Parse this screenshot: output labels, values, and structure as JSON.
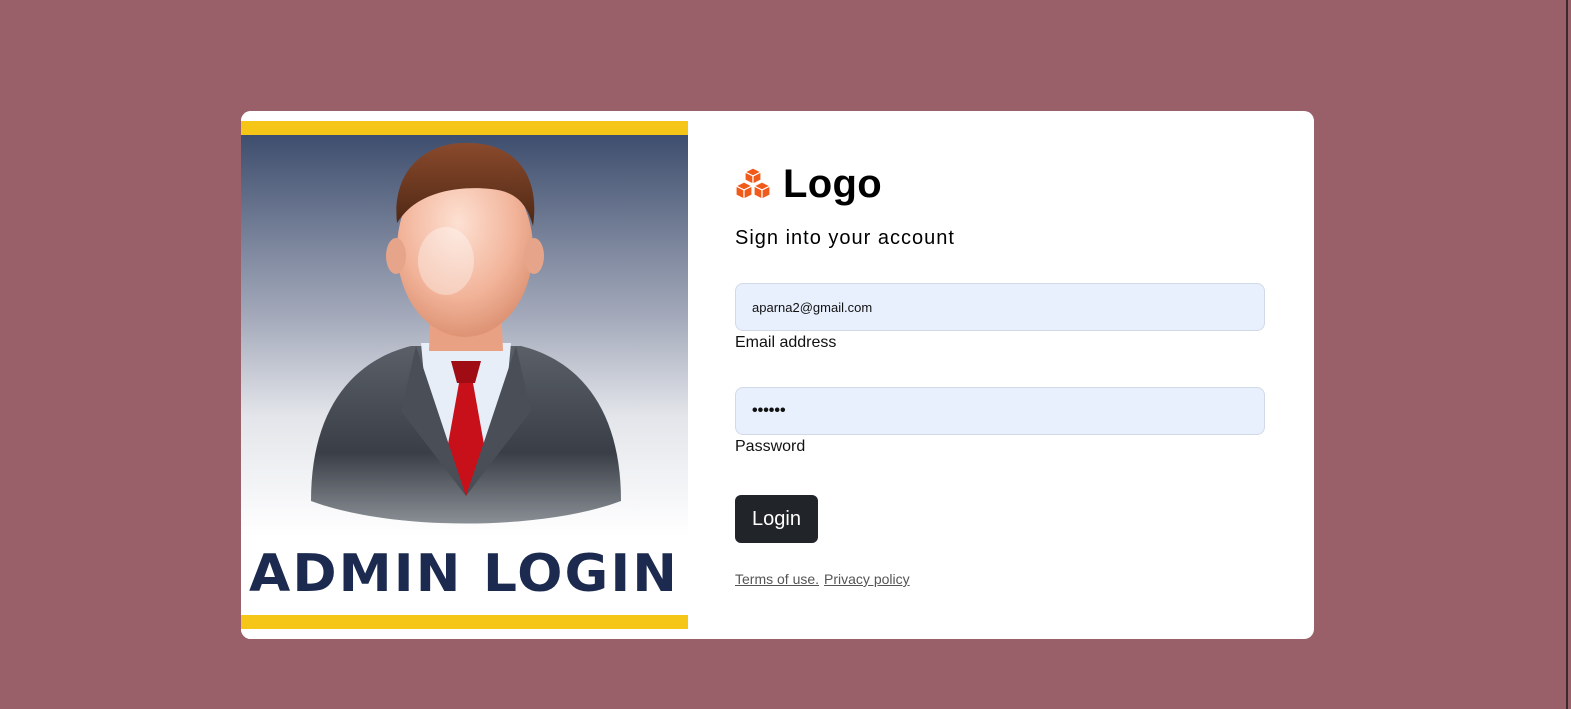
{
  "hero": {
    "image_text": "ADMIN LOGIN",
    "colors": {
      "stripe": "#f5c518",
      "title": "#1b2a4e",
      "tie": "#c8101a",
      "suit": "#3a3f47"
    }
  },
  "brand": {
    "icon": "cubes-icon",
    "icon_color": "#f05a1a",
    "name": "Logo"
  },
  "form": {
    "subtitle": "Sign into your account",
    "email_value": "aparna2@gmail.com",
    "email_label": "Email address",
    "password_value": "••••••",
    "password_label": "Password",
    "login_label": "Login"
  },
  "footer": {
    "terms": "Terms of use.",
    "privacy": "Privacy policy"
  },
  "colors": {
    "page_background": "#9a606a",
    "input_background": "#e8f0fe",
    "button_background": "#212529"
  }
}
